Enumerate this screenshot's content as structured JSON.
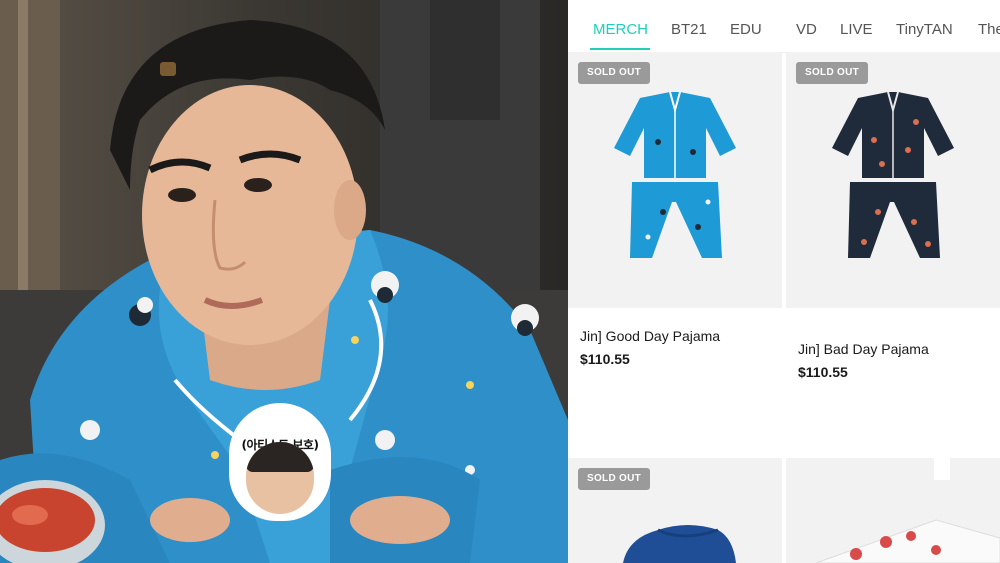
{
  "sticker": {
    "text": "(아티스트 보호)"
  },
  "store": {
    "tabs": [
      {
        "label": "MERCH",
        "active": true
      },
      {
        "label": "BT21",
        "active": false
      },
      {
        "label": "EDU",
        "active": false
      },
      {
        "label": "VD",
        "active": false
      },
      {
        "label": "LIVE",
        "active": false
      },
      {
        "label": "TinyTAN",
        "active": false
      },
      {
        "label": "The",
        "active": false
      }
    ],
    "products": [
      {
        "badge": "SOLD OUT",
        "name": "Jin] Good Day Pajama",
        "price": "$110.55",
        "image_icon": "blue-pajama-icon"
      },
      {
        "badge": "SOLD OUT",
        "name": "Jin] Bad Day Pajama",
        "price": "$110.55",
        "image_icon": "navy-pajama-icon"
      },
      {
        "badge": "SOLD OUT",
        "name": "",
        "price": "",
        "image_icon": "blue-fabric-icon"
      },
      {
        "badge": "",
        "name": "",
        "price": "",
        "image_icon": "gift-box-icon"
      }
    ],
    "colors": {
      "accent": "#1fcfb8",
      "badge": "#9a9a9a",
      "blue_pajama": "#1e9ad6",
      "navy_pajama": "#1f2a3a"
    }
  }
}
